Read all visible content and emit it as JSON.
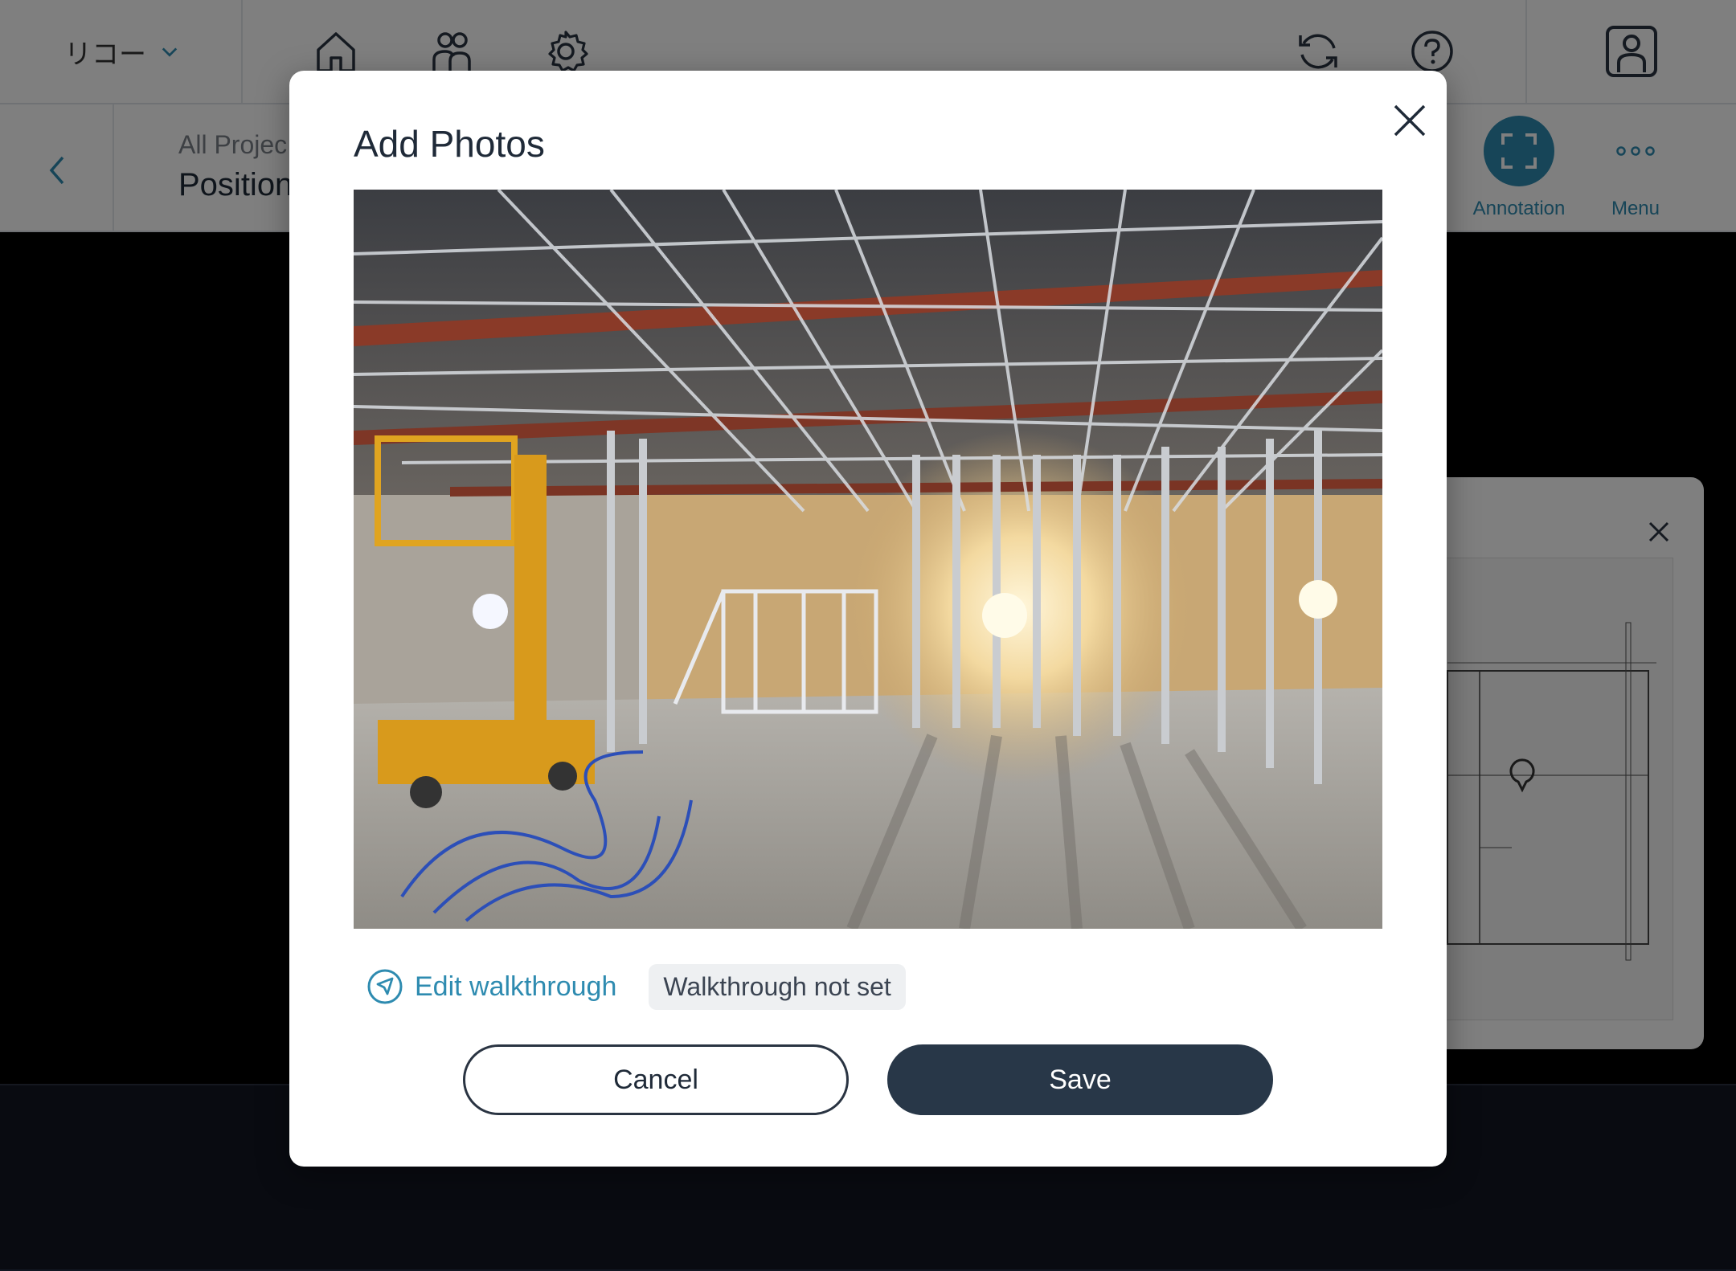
{
  "topbar": {
    "org_name": "リコー",
    "icons": [
      "home-icon",
      "users-icon",
      "gear-icon",
      "sync-icon",
      "help-icon",
      "profile-icon"
    ]
  },
  "subbar": {
    "breadcrumb": "All Projec",
    "page_title": "Position",
    "annotation_label": "Annotation",
    "menu_label": "Menu"
  },
  "modal": {
    "title": "Add Photos",
    "edit_walkthrough_label": "Edit walkthrough",
    "walkthrough_status": "Walkthrough not set",
    "cancel_label": "Cancel",
    "save_label": "Save"
  },
  "colors": {
    "accent": "#2e8bb0",
    "primary_button": "#283748",
    "text_dark": "#1f2a38"
  }
}
